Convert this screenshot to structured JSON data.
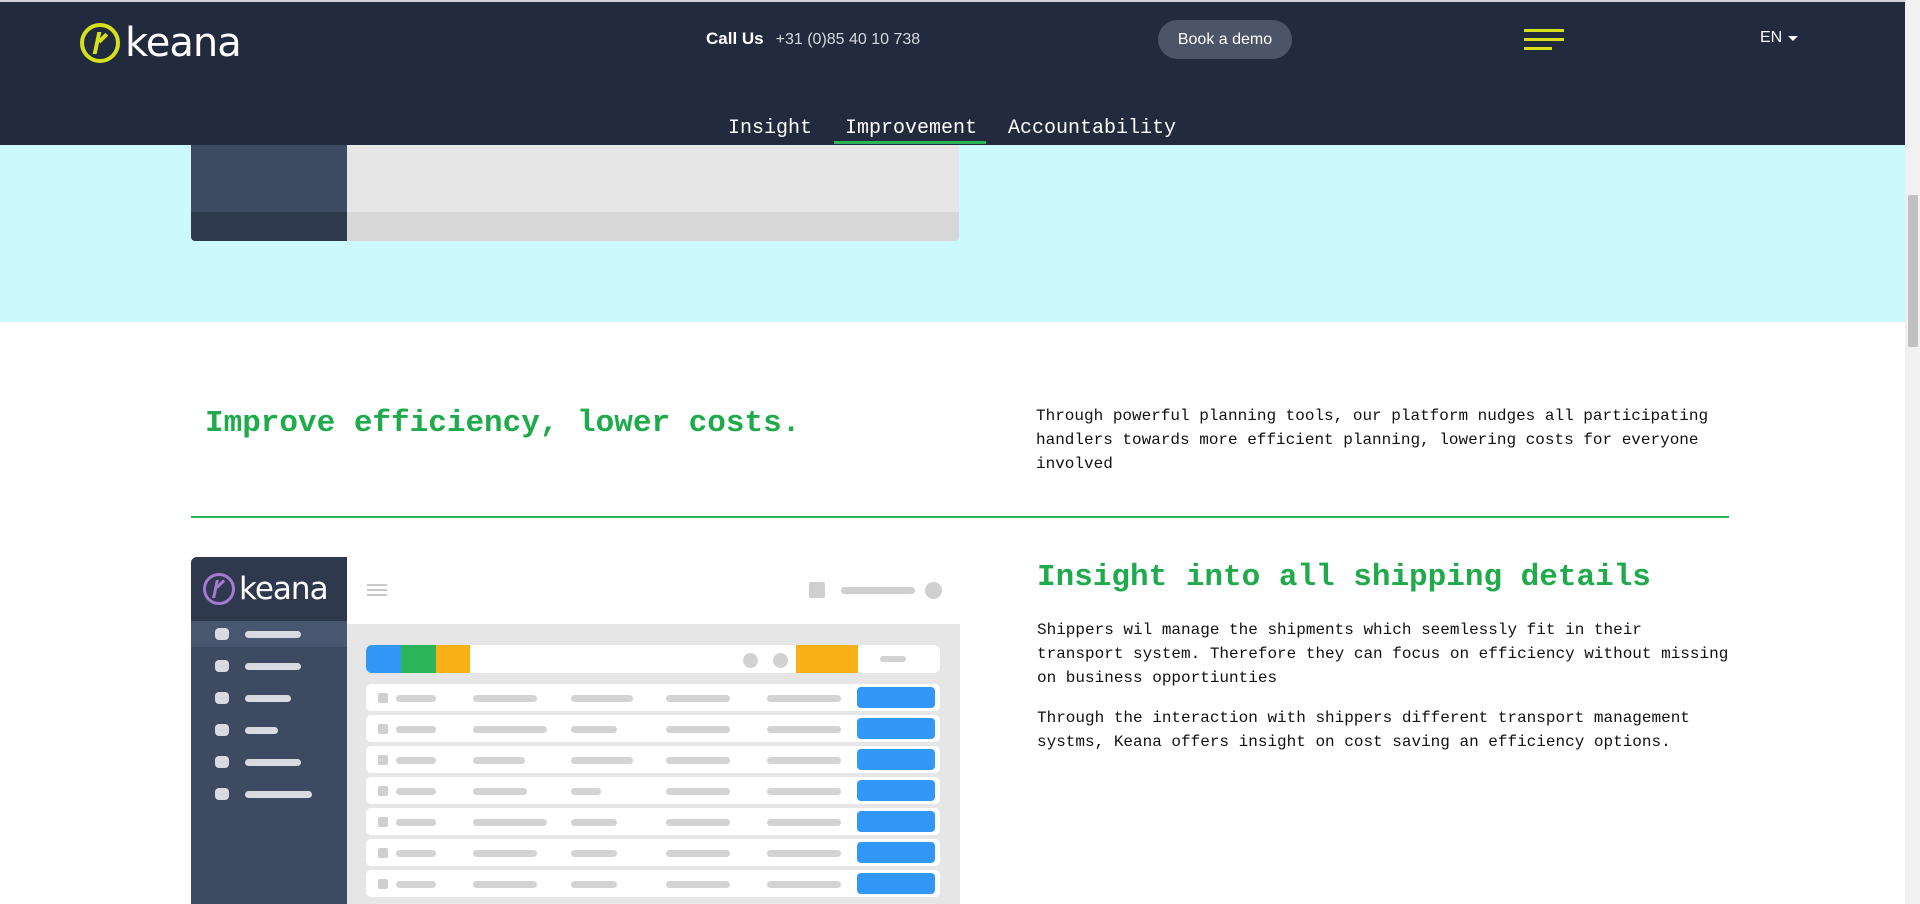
{
  "header": {
    "logo_text": "keana",
    "call_label": "Call Us",
    "phone": "+31 (0)85 40 10 738",
    "demo_button": "Book a demo",
    "language": "EN"
  },
  "tabs": [
    {
      "label": "Insight"
    },
    {
      "label": "Improvement",
      "active": true
    },
    {
      "label": "Accountability"
    }
  ],
  "section_efficiency": {
    "title": "Improve efficiency, lower costs.",
    "text": "Through powerful planning tools, our platform nudges all participating handlers towards more efficient planning, lowering costs for everyone involved"
  },
  "section_insight": {
    "title": "Insight into all shipping details",
    "paragraph_1": "Shippers wil manage the shipments which seemlessly fit in their transport system. Therefore they can focus on efficiency without missing on business opportiunties",
    "paragraph_2": "Through the interaction with shippers different transport management systms, Keana offers insight on cost saving an efficiency options."
  },
  "dashboard_mockup": {
    "logo_text": "keana",
    "filter_colors": [
      "#3397f7",
      "#2bb45a",
      "#f9b016"
    ]
  },
  "colors": {
    "nav_bg": "#212b3d",
    "accent_yellow": "#d7e11b",
    "accent_green": "#1faa4c",
    "cyan_band": "#ccf9fb",
    "button_blue": "#3397f7"
  }
}
